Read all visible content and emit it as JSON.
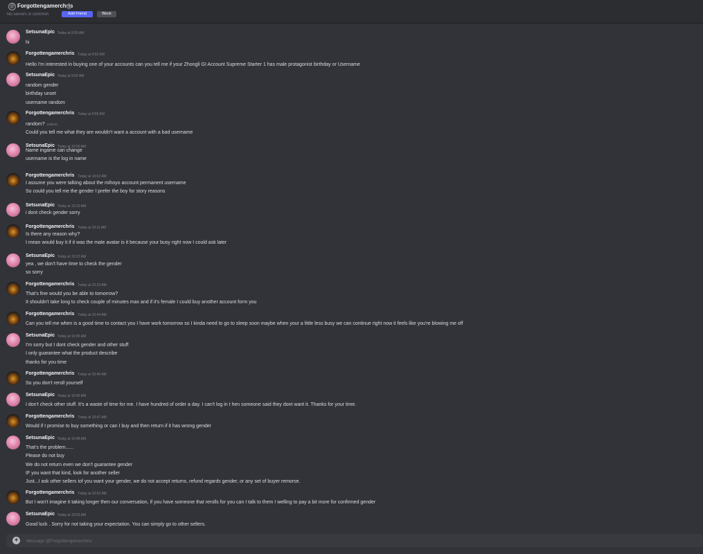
{
  "header": {
    "at_symbol": "@",
    "title": "Forgottengamerchris",
    "mutual_servers": "No servers in common",
    "add_friend_label": "Add Friend",
    "block_label": "Block"
  },
  "messages": [
    {
      "author": "SetsunaEpic",
      "avatar": "setsuna",
      "timestamp": "Today at 9:55 AM",
      "lines": [
        "hi"
      ]
    },
    {
      "author": "Forgottengamerchris",
      "avatar": "chris",
      "timestamp": "Today at 9:53 AM",
      "lines": [
        "Hello I'm interested in buying one of your accounts can you tell me if your Zhongli GI Account Supreme Starter 1  has male protagonist birthday or Username"
      ]
    },
    {
      "author": "SetsunaEpic",
      "avatar": "setsuna",
      "timestamp": "Today at 9:55 AM",
      "lines": [
        "random gender",
        "birthday unset",
        "username random"
      ]
    },
    {
      "author": "Forgottengamerchris",
      "avatar": "chris",
      "timestamp": "Today at 9:55 AM",
      "lines": [
        "random?",
        "Could you tell me what they are wouldn't want a account with a bad username"
      ],
      "edited_line": 0,
      "edited_label": "(edited)"
    },
    {
      "author": "SetsunaEpic",
      "avatar": "setsuna",
      "timestamp": "Today at 10:00 AM",
      "lines": [
        "Name ingame can change",
        "username is the log in name"
      ]
    },
    {
      "author": "Forgottengamerchris",
      "avatar": "chris",
      "timestamp": "Today at 10:02 AM",
      "lines": [
        "I assume you were talking about the mihoyo account permanent username",
        "So could you tell me the gender I prefer the boy for story reasons"
      ]
    },
    {
      "author": "SetsunaEpic",
      "avatar": "setsuna",
      "timestamp": "Today at 10:10 AM",
      "lines": [
        "i dont check gender sorry"
      ]
    },
    {
      "author": "Forgottengamerchris",
      "avatar": "chris",
      "timestamp": "Today at 10:11 AM",
      "lines": [
        "Is there any reason why?",
        "I mean would buy it if it was the male avatar is it because your busy right now I could ask later"
      ]
    },
    {
      "author": "SetsunaEpic",
      "avatar": "setsuna",
      "timestamp": "Today at 10:22 AM",
      "lines": [
        "yea , we don't have time to check the gender",
        "so sorry"
      ]
    },
    {
      "author": "Forgottengamerchris",
      "avatar": "chris",
      "timestamp": "Today at 10:23 AM",
      "lines": [
        "That's fine would you be able to tomorrow?",
        "It shouldn't take long to check couple of minutes max and if it's female I could buy another account form you"
      ]
    },
    {
      "author": "Forgottengamerchris",
      "avatar": "chris",
      "timestamp": "Today at 10:44 AM",
      "lines": [
        "Can you tell me when is a good time to contact you I have work tomorrow so I kinda need to go to sleep soon maybe when your a little less busy we can continue right now it feels like you're blowing me off"
      ]
    },
    {
      "author": "SetsunaEpic",
      "avatar": "setsuna",
      "timestamp": "Today at 10:45 AM",
      "lines": [
        "I'm sorry but I dont check gender and other stuff",
        "I only guarantee what the product describe",
        "thanks for you time"
      ]
    },
    {
      "author": "Forgottengamerchris",
      "avatar": "chris",
      "timestamp": "Today at 10:46 AM",
      "lines": [
        "So you don't reroll yourself"
      ]
    },
    {
      "author": "SetsunaEpic",
      "avatar": "setsuna",
      "timestamp": "Today at 10:46 AM",
      "lines": [
        "I don't check other stuff. It's a waste of time for me. I have hundred of order a day. I can't log in t hen someone said they dont want it. Thanks for your time."
      ]
    },
    {
      "author": "Forgottengamerchris",
      "avatar": "chris",
      "timestamp": "Today at 10:47 AM",
      "lines": [
        "Would if I promise to buy something or can I buy and then return if it has wrong gender"
      ]
    },
    {
      "author": "SetsunaEpic",
      "avatar": "setsuna",
      "timestamp": "Today at 10:48 AM",
      "lines": [
        "That's the problem......",
        "Please do not buy",
        "We do not return even we don't guarantee gender",
        "IF you want that kind, look for another seller",
        "Just...I ask other sellers iof you want your gender, we do not accept returns, refund regards gender, or any set of buyer remorse."
      ]
    },
    {
      "author": "Forgottengamerchris",
      "avatar": "chris",
      "timestamp": "Today at 10:52 AM",
      "lines": [
        "But I won't imagine it taking longer then our conversation, if you have someone that rerolls for you can I talk to them I welling to pay a bit more for confirmed gender"
      ]
    },
    {
      "author": "SetsunaEpic",
      "avatar": "setsuna",
      "timestamp": "Today at 10:53 AM",
      "lines": [
        "Good luck . Sorry for not taking your expectation. You can simply go to other sellers."
      ]
    }
  ],
  "composer": {
    "placeholder": "Message @Forgottengamerchris",
    "add_icon": "+"
  }
}
